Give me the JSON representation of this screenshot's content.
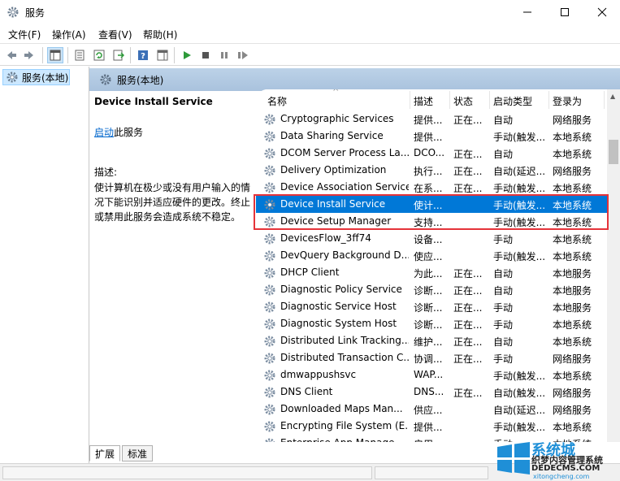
{
  "window": {
    "title": "服务"
  },
  "menu": [
    "文件(F)",
    "操作(A)",
    "查看(V)",
    "帮助(H)"
  ],
  "tree": {
    "root_label": "服务(本地)"
  },
  "pane": {
    "header": "服务(本地)",
    "selected_title": "Device Install Service",
    "start_link": "启动",
    "start_suffix": "此服务",
    "desc_label": "描述:",
    "desc_body": "使计算机在极少或没有用户输入的情况下能识别并适应硬件的更改。终止或禁用此服务会造成系统不稳定。"
  },
  "columns": {
    "name": "名称",
    "desc": "描述",
    "status": "状态",
    "startup": "启动类型",
    "logon": "登录为"
  },
  "rows": [
    {
      "name": "Cryptographic Services",
      "desc": "提供...",
      "status": "正在...",
      "startup": "自动",
      "logon": "网络服务"
    },
    {
      "name": "Data Sharing Service",
      "desc": "提供...",
      "status": "",
      "startup": "手动(触发...",
      "logon": "本地系统"
    },
    {
      "name": "DCOM Server Process La...",
      "desc": "DCO...",
      "status": "正在...",
      "startup": "自动",
      "logon": "本地系统"
    },
    {
      "name": "Delivery Optimization",
      "desc": "执行...",
      "status": "正在...",
      "startup": "自动(延迟...",
      "logon": "网络服务"
    },
    {
      "name": "Device Association Service",
      "desc": "在系...",
      "status": "正在...",
      "startup": "手动(触发...",
      "logon": "本地系统"
    },
    {
      "name": "Device Install Service",
      "desc": "使计...",
      "status": "",
      "startup": "手动(触发...",
      "logon": "本地系统",
      "selected": true
    },
    {
      "name": "Device Setup Manager",
      "desc": "支持...",
      "status": "",
      "startup": "手动(触发...",
      "logon": "本地系统"
    },
    {
      "name": "DevicesFlow_3ff74",
      "desc": "设备...",
      "status": "",
      "startup": "手动",
      "logon": "本地系统"
    },
    {
      "name": "DevQuery Background D...",
      "desc": "使应...",
      "status": "",
      "startup": "手动(触发...",
      "logon": "本地系统"
    },
    {
      "name": "DHCP Client",
      "desc": "为此...",
      "status": "正在...",
      "startup": "自动",
      "logon": "本地服务"
    },
    {
      "name": "Diagnostic Policy Service",
      "desc": "诊断...",
      "status": "正在...",
      "startup": "自动",
      "logon": "本地服务"
    },
    {
      "name": "Diagnostic Service Host",
      "desc": "诊断...",
      "status": "正在...",
      "startup": "手动",
      "logon": "本地服务"
    },
    {
      "name": "Diagnostic System Host",
      "desc": "诊断...",
      "status": "正在...",
      "startup": "手动",
      "logon": "本地系统"
    },
    {
      "name": "Distributed Link Tracking...",
      "desc": "维护...",
      "status": "正在...",
      "startup": "自动",
      "logon": "本地系统"
    },
    {
      "name": "Distributed Transaction C...",
      "desc": "协调...",
      "status": "正在...",
      "startup": "手动",
      "logon": "网络服务"
    },
    {
      "name": "dmwappushsvc",
      "desc": "WAP...",
      "status": "",
      "startup": "手动(触发...",
      "logon": "本地系统"
    },
    {
      "name": "DNS Client",
      "desc": "DNS...",
      "status": "正在...",
      "startup": "自动(触发...",
      "logon": "网络服务"
    },
    {
      "name": "Downloaded Maps Man...",
      "desc": "供应...",
      "status": "",
      "startup": "自动(延迟...",
      "logon": "网络服务"
    },
    {
      "name": "Encrypting File System (E...",
      "desc": "提供...",
      "status": "",
      "startup": "手动(触发...",
      "logon": "本地系统"
    },
    {
      "name": "Enterprise App Manage...",
      "desc": "启用...",
      "status": "",
      "startup": "手动",
      "logon": "本地系统"
    }
  ],
  "tabs": [
    "扩展",
    "标准"
  ],
  "watermark": {
    "brand": "系统城",
    "line1": "织梦内容管理系统",
    "line2": "DEDECMS.COM",
    "line3": "xitongcheng.com"
  },
  "colors": {
    "selection": "#0078d7",
    "highlight_box": "#e5333a",
    "header_band": "#b3cbe3"
  }
}
